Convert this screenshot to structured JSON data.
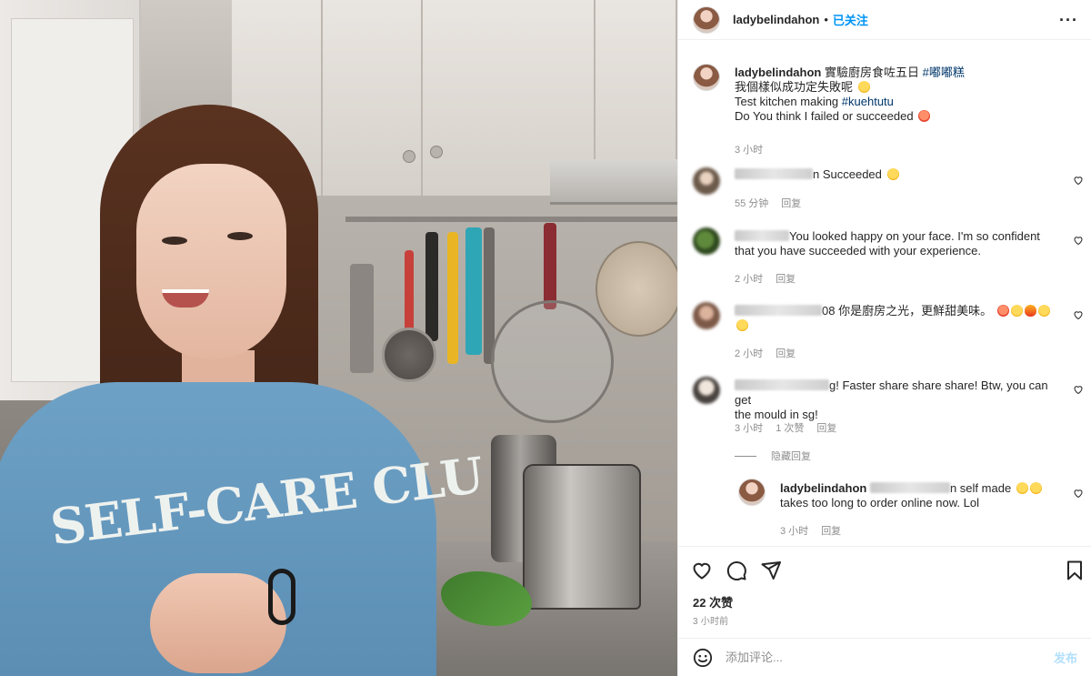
{
  "post": {
    "username": "ladybelindahon",
    "dot": "•",
    "follow_label": "已关注",
    "more_label": "···",
    "sweater_text": "SELF-CARE CLU"
  },
  "caption": {
    "username": "ladybelindahon",
    "line1": "實驗廚房食咗五日",
    "hashtag1": "#嘟嘟糕",
    "line2": "我個樣似成功定失敗呢",
    "line3": "Test kitchen making",
    "hashtag2": "#kuehtutu",
    "line4": "Do You think I failed or succeeded",
    "time": "3 小时"
  },
  "comments": [
    {
      "text": "n Succeeded",
      "time": "55 分钟",
      "reply_label": "回复",
      "emoji": "smile"
    },
    {
      "text_line1": "You looked happy on your face. I'm so confident",
      "text_line2": "that you have succeeded with your experience.",
      "time": "2 小时",
      "reply_label": "回复"
    },
    {
      "text": "08 你是廚房之光，更鮮甜美味。",
      "time": "2 小时",
      "reply_label": "回复"
    },
    {
      "text_line1": "g! Faster share share share! Btw, you can get",
      "text_line2": "the mould in sg!",
      "time": "3 小时",
      "likes": "1 次赞",
      "reply_label": "回复"
    }
  ],
  "hide_replies_label": "隐藏回复",
  "reply": {
    "username": "ladybelindahon",
    "text_line1": "n self made",
    "text_line2": "takes too long to order online now. Lol",
    "time": "3 小时",
    "reply_label": "回复"
  },
  "actions": {
    "icons": [
      "heart-icon",
      "comment-icon",
      "share-icon",
      "bookmark-icon"
    ]
  },
  "likes": "22 次赞",
  "timestamp": "3 小时前",
  "add_comment": {
    "placeholder": "添加评论...",
    "post_label": "发布"
  },
  "colors": {
    "follow": "#0095f6",
    "hashtag": "#00376b",
    "post_button_disabled": "#b2dffc",
    "sweater": "#6ea1c6"
  }
}
